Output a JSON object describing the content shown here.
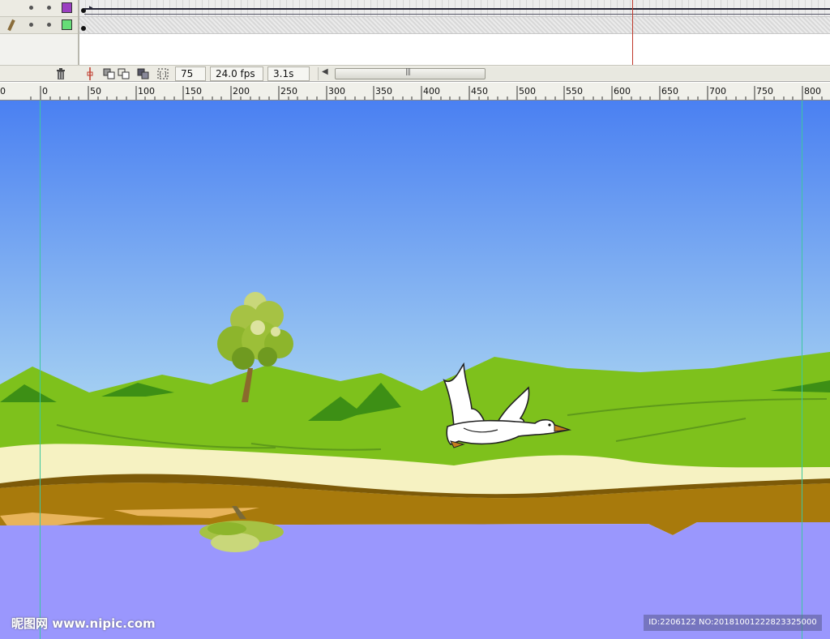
{
  "timeline": {
    "layers": [
      {
        "color": "#9b3fc1"
      },
      {
        "color": "#66dd77"
      }
    ],
    "current_frame": "75",
    "frame_rate": "24.0 fps",
    "elapsed_time": "3.1s"
  },
  "ruler": {
    "labels": [
      "0",
      "0",
      "50",
      "100",
      "150",
      "200",
      "250",
      "300",
      "350",
      "400",
      "450",
      "500",
      "550",
      "600",
      "650",
      "700",
      "750",
      "800"
    ]
  },
  "stage": {
    "colors": {
      "sky_top": "#4a80f2",
      "sky_bottom": "#a7d2f2",
      "grass": "#7ec11c",
      "grass_dark": "#3d8f15",
      "sand": "#f6f2c2",
      "mud": "#a87a0c",
      "water": "#9a97fd",
      "guide": "#3cc7a0"
    }
  },
  "icons": {
    "trash": "trash-icon",
    "onion_skin": "onion-skin-icon",
    "center_frame": "center-frame-icon",
    "edit_multiple": "edit-multiple-frames-icon",
    "modify_markers": "modify-onion-markers-icon"
  },
  "watermark": {
    "left_text": "昵图网 www.nipic.com",
    "right_text": "ID:2206122 NO:20181001222823325000"
  }
}
